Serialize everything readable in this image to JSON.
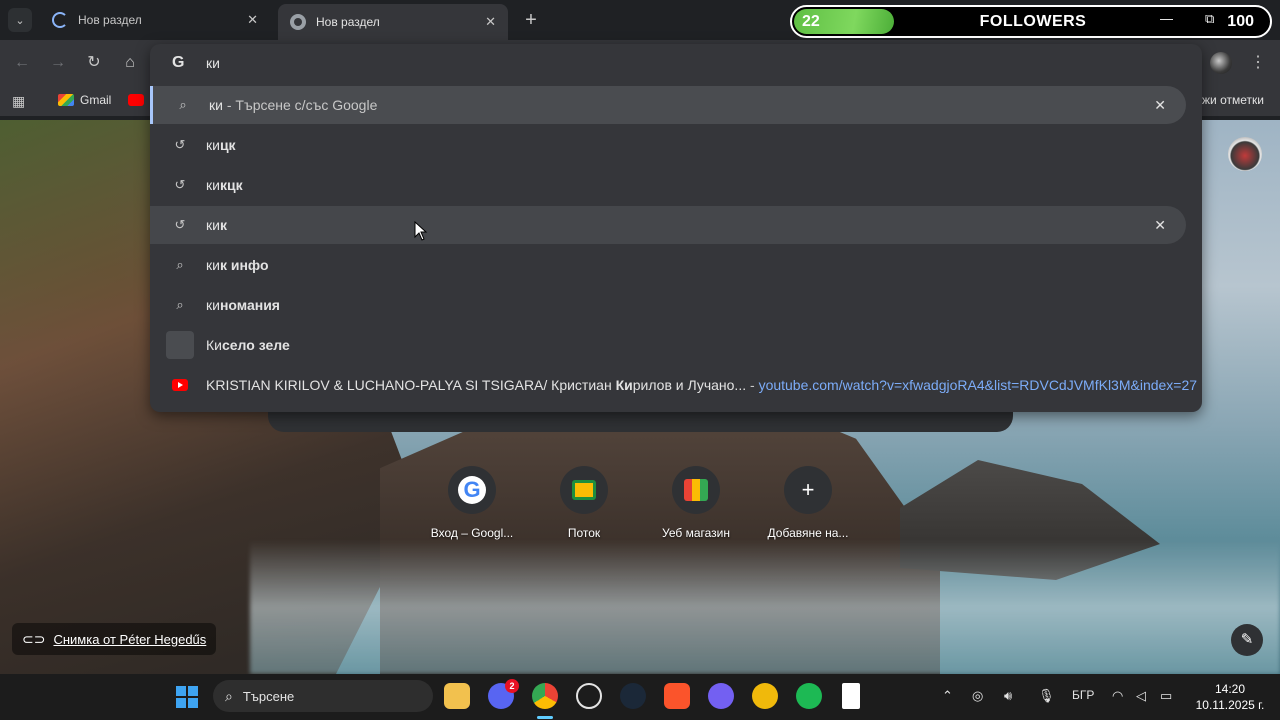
{
  "tabs": [
    {
      "title": "Нов раздел",
      "icon": "loading-spinner-icon"
    },
    {
      "title": "Нов раздел",
      "icon": "chrome-icon"
    }
  ],
  "overlay": {
    "count": "22",
    "label": "FOLLOWERS",
    "goal": "100"
  },
  "omnibox": {
    "input": "ки",
    "suggestions": [
      {
        "icon": "search-icon",
        "prefix": "ки",
        "rest": " - Търсене с/със Google",
        "type": "search-what-you-typed",
        "removable": true
      },
      {
        "icon": "history-icon",
        "prefix": "ки",
        "rest": "цк",
        "type": "history"
      },
      {
        "icon": "history-icon",
        "prefix": "ки",
        "rest": "кцк",
        "type": "history"
      },
      {
        "icon": "history-icon",
        "prefix": "ки",
        "rest": "к",
        "type": "history",
        "removable": true
      },
      {
        "icon": "search-icon",
        "prefix": "ки",
        "rest": "к инфо",
        "type": "search"
      },
      {
        "icon": "search-icon",
        "prefix": "ки",
        "rest": "номания",
        "type": "search"
      },
      {
        "icon": "thumbnail",
        "prefix": "Ки",
        "rest": "село зеле",
        "type": "entity"
      },
      {
        "icon": "youtube-icon",
        "text_before": "KRISTIAN KIRILOV & LUCHANO-PALYA SI TSIGARA/ Кристиан ",
        "bold": "Ки",
        "text_after": "рилов и Лучано...",
        "separator": " - ",
        "url": "youtube.com/watch?v=xfwadgjoRA4&list=RDVCdJVMfKl3M&index=27",
        "type": "url"
      }
    ]
  },
  "bookmarks": {
    "gmail": "Gmail",
    "other": "жи отметки"
  },
  "shortcuts": [
    {
      "label": "Вход – Googl...",
      "icon": "google-icon"
    },
    {
      "label": "Поток",
      "icon": "classroom-icon"
    },
    {
      "label": "Уеб магазин",
      "icon": "web-store-icon"
    },
    {
      "label": "Добавяне на...",
      "icon": "add-icon"
    }
  ],
  "photo_credit": "Снимка от Péter Hegedűs",
  "taskbar": {
    "search_placeholder": "Търсене",
    "discord_badge": "2",
    "language": "БГР",
    "time": "14:20",
    "date": "10.11.2025 г."
  }
}
